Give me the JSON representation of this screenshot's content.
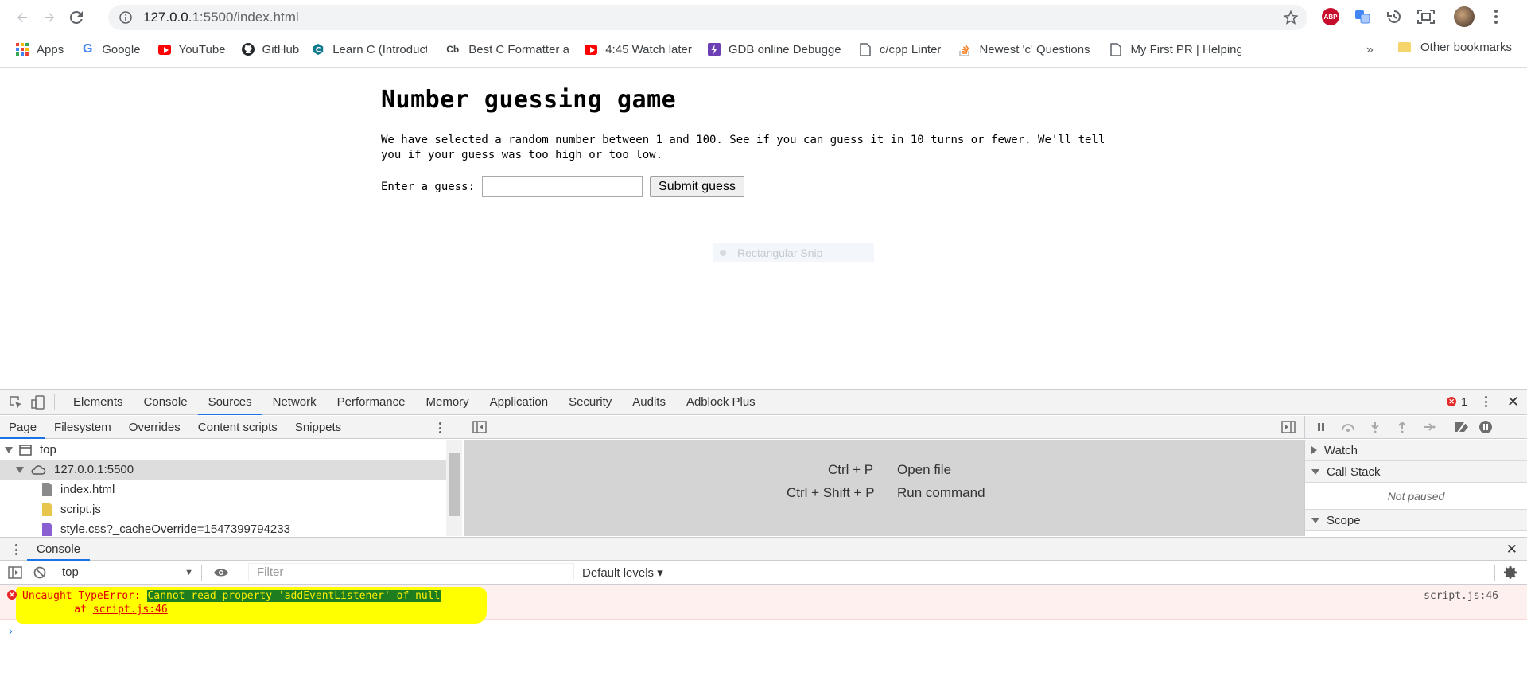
{
  "browser": {
    "url_host": "127.0.0.1",
    "url_path": ":5500/index.html",
    "bookmarks": [
      {
        "label": "Apps",
        "icon": "apps-icon"
      },
      {
        "label": "Google",
        "icon": "google-icon"
      },
      {
        "label": "YouTube",
        "icon": "youtube-icon"
      },
      {
        "label": "GitHub",
        "icon": "github-icon"
      },
      {
        "label": "Learn C (Introduction",
        "icon": "learnc-icon"
      },
      {
        "label": "Best C Formatter and",
        "icon": "cb-icon"
      },
      {
        "label": "4:45 Watch later",
        "icon": "youtube-icon"
      },
      {
        "label": "GDB online Debugge",
        "icon": "gdb-icon"
      },
      {
        "label": "c/cpp Linter",
        "icon": "page-icon"
      },
      {
        "label": "Newest 'c' Questions",
        "icon": "stackoverflow-icon"
      },
      {
        "label": "My First PR | Helping",
        "icon": "page-icon"
      }
    ],
    "more_bookmarks": "»",
    "other_bookmarks": "Other bookmarks",
    "abp_label": "ABP"
  },
  "page": {
    "title": "Number guessing game",
    "description": "We have selected a random number between 1 and 100. See if you can guess it in 10 turns or fewer. We'll tell you if your guess was too high or too low.",
    "guess_label": "Enter a guess:",
    "guess_value": "",
    "submit_label": "Submit guess",
    "snip_label": "Rectangular Snip"
  },
  "devtools": {
    "tabs": [
      "Elements",
      "Console",
      "Sources",
      "Network",
      "Performance",
      "Memory",
      "Application",
      "Security",
      "Audits",
      "Adblock Plus"
    ],
    "active_tab": "Sources",
    "error_count": "1",
    "sources_subtabs": [
      "Page",
      "Filesystem",
      "Overrides",
      "Content scripts",
      "Snippets"
    ],
    "tree": {
      "top": "top",
      "host": "127.0.0.1:5500",
      "files": [
        "index.html",
        "script.js",
        "style.css?_cacheOverride=1547399794233"
      ]
    },
    "shortcuts": [
      {
        "keys": "Ctrl + P",
        "action": "Open file"
      },
      {
        "keys": "Ctrl + Shift + P",
        "action": "Run command"
      }
    ],
    "debug_panes": {
      "watch": "Watch",
      "call_stack": "Call Stack",
      "not_paused": "Not paused",
      "scope": "Scope"
    },
    "drawer": {
      "tab": "Console",
      "context": "top",
      "filter_placeholder": "Filter",
      "levels": "Default levels ▾",
      "error_prefix": "Uncaught TypeError: ",
      "error_message": "Cannot read property 'addEventListener' of null",
      "error_at_prefix": "    at ",
      "error_at_link": "script.js:46",
      "error_source": "script.js:46",
      "prompt": "›"
    }
  }
}
